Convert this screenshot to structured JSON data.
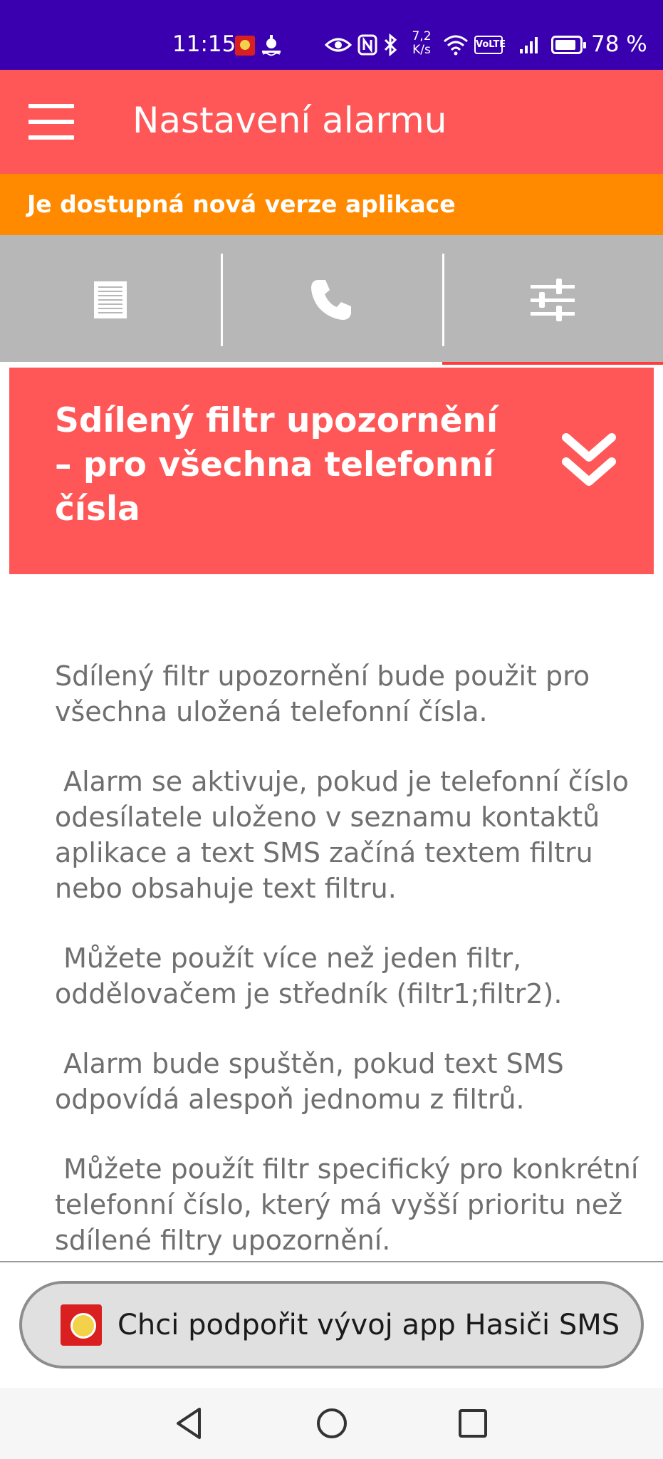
{
  "status_bar": {
    "time": "11:15",
    "speed_value": "7,2",
    "speed_unit": "K/s",
    "volte": "VoLTE",
    "battery_percent": "78 %",
    "icons": [
      "app-notification-icon",
      "alarm-icon",
      "eye-icon",
      "nfc-icon",
      "bluetooth-icon",
      "wifi-icon",
      "signal-icon",
      "battery-icon"
    ]
  },
  "app_bar": {
    "title": "Nastavení alarmu",
    "menu_icon": "hamburger-menu-icon"
  },
  "update_banner": {
    "text": "Je dostupná nová verze aplikace"
  },
  "tabs": [
    {
      "icon": "document-icon",
      "active": false
    },
    {
      "icon": "phone-icon",
      "active": false
    },
    {
      "icon": "sliders-icon",
      "active": true
    }
  ],
  "card": {
    "title": "Sdílený filtr upozornění – pro všechna telefonní čísla",
    "chevron_icon": "double-chevron-down-icon"
  },
  "body": {
    "paragraphs": [
      "Sdílený filtr upozornění bude použit pro všechna uložená telefonní čísla.",
      " Alarm se aktivuje, pokud je telefonní číslo odesílatele uloženo v seznamu kontaktů aplikace a text SMS začíná textem filtru nebo obsahuje text filtru.",
      " Můžete použít více než jeden filtr, oddělovačem je středník (filtr1;filtr2).",
      " Alarm bude spuštěn, pokud text SMS odpovídá alespoň jednomu z filtrů.",
      " Můžete použít filtr specifický pro konkrétní telefonní číslo, který má vyšší prioritu než sdílené filtry upozornění."
    ]
  },
  "support_button": {
    "label": "Chci podpořit vývoj app Hasiči SMS",
    "icon": "hasici-app-icon"
  },
  "nav_bar": {
    "buttons": [
      "back-icon",
      "home-icon",
      "recents-icon"
    ]
  },
  "colors": {
    "status_bar": "#3a00b0",
    "accent_red": "#ff5757",
    "banner_orange": "#ff8a00",
    "tabs_gray": "#b7b7b7",
    "body_text": "#6f6f6f"
  }
}
